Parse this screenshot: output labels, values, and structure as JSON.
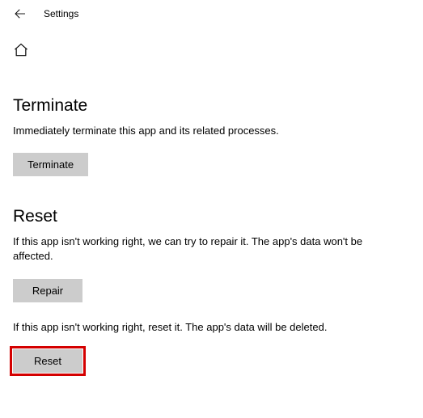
{
  "header": {
    "title": "Settings"
  },
  "sections": {
    "terminate": {
      "title": "Terminate",
      "description": "Immediately terminate this app and its related processes.",
      "button_label": "Terminate"
    },
    "reset": {
      "title": "Reset",
      "repair_description": "If this app isn't working right, we can try to repair it. The app's data won't be affected.",
      "repair_button_label": "Repair",
      "reset_description": "If this app isn't working right, reset it. The app's data will be deleted.",
      "reset_button_label": "Reset"
    }
  }
}
